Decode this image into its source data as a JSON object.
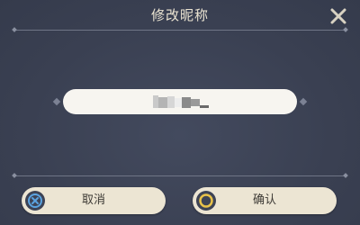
{
  "dialog": {
    "title": "修改昵称"
  },
  "nickname_input": {
    "value": ""
  },
  "buttons": {
    "cancel_label": "取消",
    "confirm_label": "确认"
  },
  "icons": {
    "close": "close-icon",
    "cancel": "cross-circle-icon",
    "confirm": "ring-circle-icon"
  },
  "colors": {
    "panel": "#3a4052",
    "title_text": "#ece5d3",
    "button_bg": "#ece5d3",
    "input_bg": "#f7f5f0",
    "cancel_icon": "#5ba3e0",
    "confirm_icon": "#e8c24a"
  }
}
